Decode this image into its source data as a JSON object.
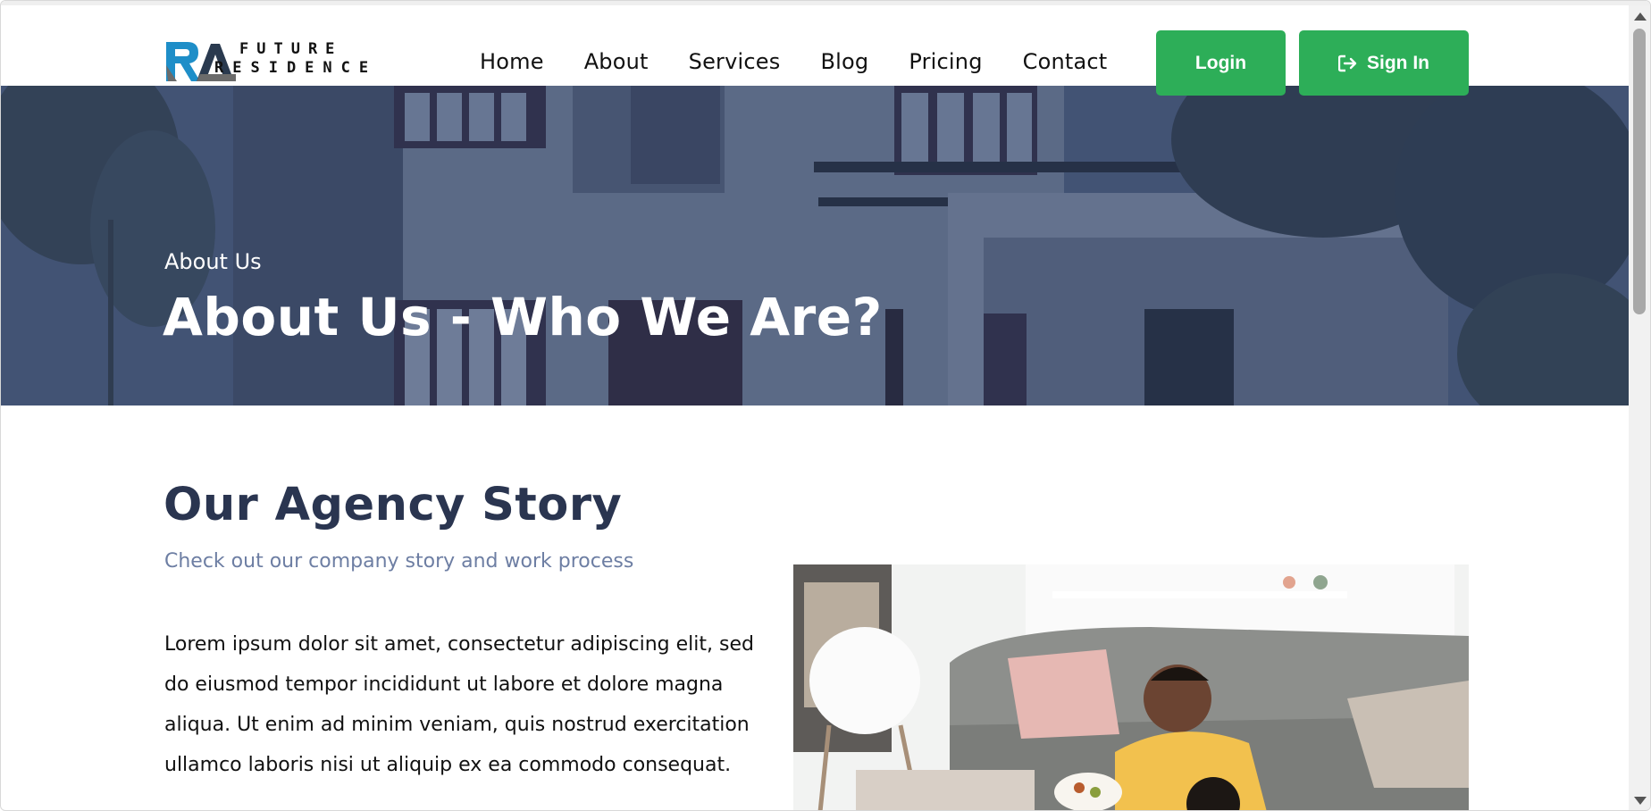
{
  "brand": {
    "line1": "FUTURE",
    "line2": "RESIDENCE",
    "logo_mark": "RA",
    "accent": "#1e8ec8"
  },
  "nav": {
    "items": [
      "Home",
      "About",
      "Services",
      "Blog",
      "Pricing",
      "Contact"
    ]
  },
  "auth": {
    "login_label": "Login",
    "signin_label": "Sign In",
    "button_color": "#2dae58"
  },
  "hero": {
    "kicker": "About Us",
    "title": "About Us - Who We Are?"
  },
  "story": {
    "title": "Our Agency Story",
    "subtitle": "Check out our company story and work process",
    "body": "Lorem ipsum dolor sit amet, consectetur adipiscing elit, sed do eiusmod tempor incididunt ut labore et dolore magna aliqua. Ut enim ad minim veniam, quis nostrud exercitation ullamco laboris nisi ut aliquip ex ea commodo consequat."
  }
}
